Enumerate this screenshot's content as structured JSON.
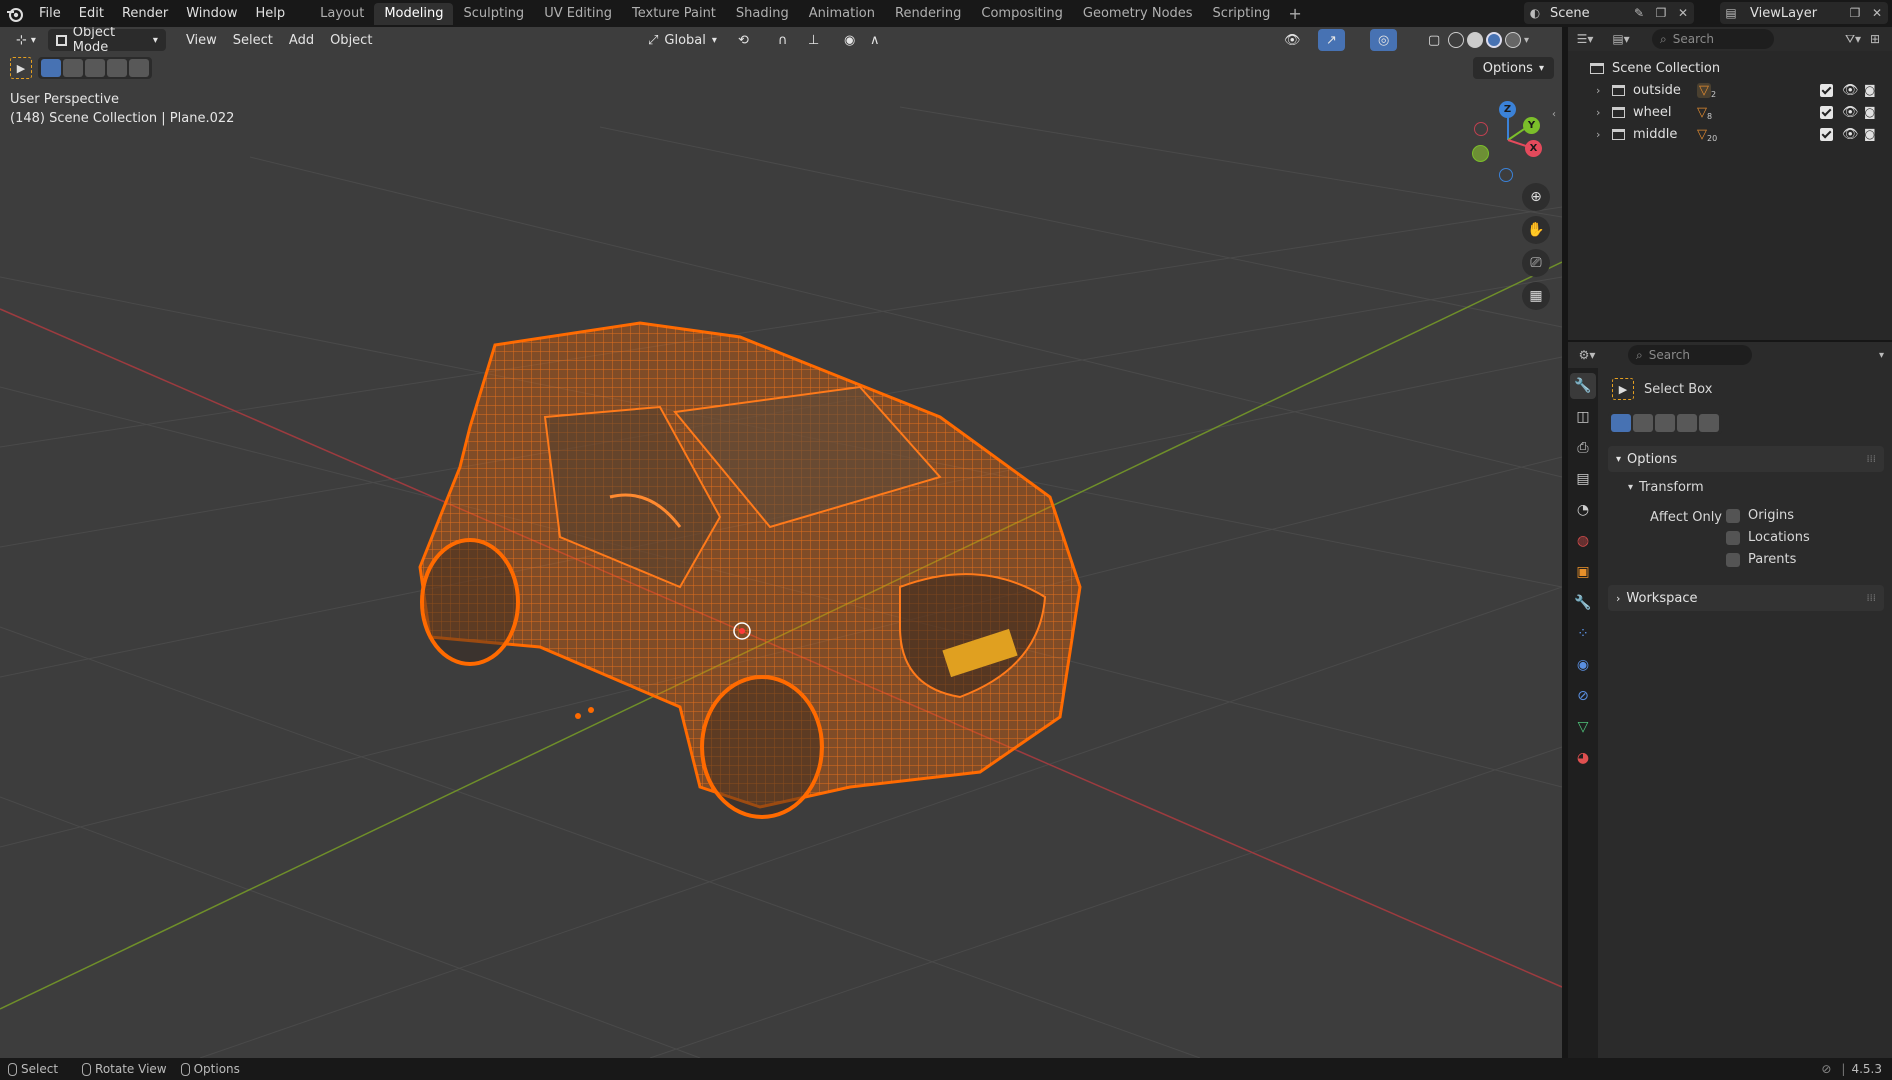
{
  "topbar": {
    "menus": [
      "File",
      "Edit",
      "Render",
      "Window",
      "Help"
    ],
    "workspaces": [
      "Layout",
      "Modeling",
      "Sculpting",
      "UV Editing",
      "Texture Paint",
      "Shading",
      "Animation",
      "Rendering",
      "Compositing",
      "Geometry Nodes",
      "Scripting"
    ],
    "active_workspace": "Modeling",
    "add_tab": "+",
    "scene": "Scene",
    "view_layer": "ViewLayer"
  },
  "viewport": {
    "mode": "Object Mode",
    "menus": [
      "View",
      "Select",
      "Add",
      "Object"
    ],
    "orientation": "Global",
    "options_label": "Options",
    "perspective_label": "User Perspective",
    "selection_info": "(148) Scene Collection | Plane.022",
    "gizmo": {
      "z": "Z",
      "y": "Y",
      "x": "X"
    }
  },
  "outliner": {
    "search_placeholder": "Search",
    "root": "Scene Collection",
    "collections": [
      {
        "name": "outside",
        "count": "2"
      },
      {
        "name": "wheel",
        "count": "8"
      },
      {
        "name": "middle",
        "count": "20"
      }
    ]
  },
  "properties": {
    "search_placeholder": "Search",
    "tool_name": "Select Box",
    "options_panel": "Options",
    "transform_panel": "Transform",
    "affect_only_label": "Affect Only",
    "affect_options": [
      "Origins",
      "Locations",
      "Parents"
    ],
    "workspace_panel": "Workspace"
  },
  "statusbar": {
    "items": [
      "Select",
      "Rotate View",
      "Options"
    ],
    "version": "4.5.3"
  },
  "colors": {
    "accent": "#4772b3",
    "selection_orange": "#ff6a00",
    "axis_x": "#e44a5c",
    "axis_y": "#7bbf2a",
    "axis_z": "#3b82d8"
  }
}
